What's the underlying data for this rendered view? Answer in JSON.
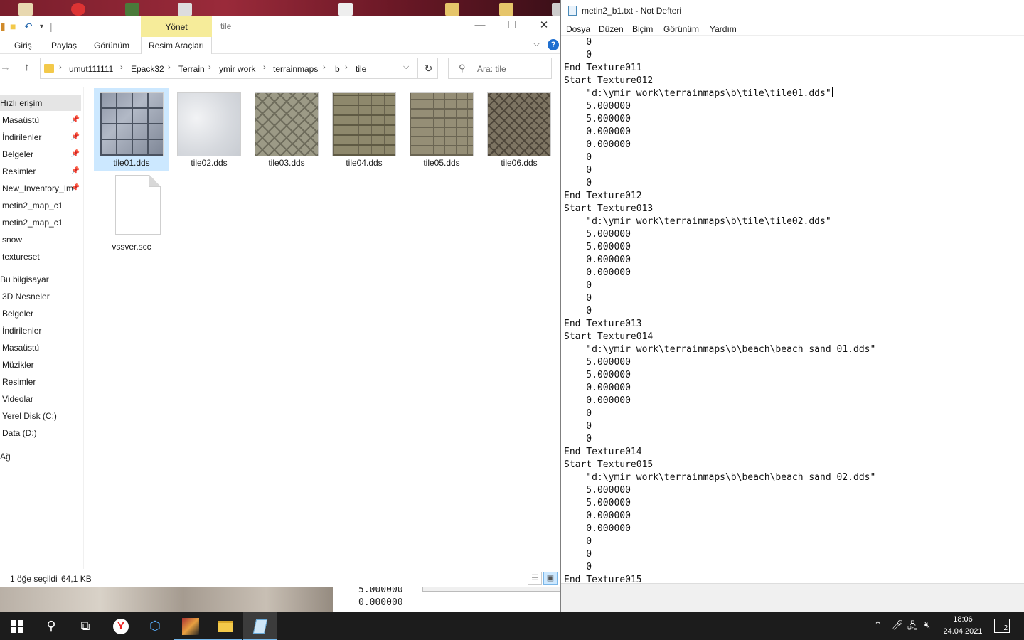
{
  "explorer": {
    "title": "tile",
    "manage_tab": "Yönet",
    "ribbon_tabs": [
      "Giriş",
      "Paylaş",
      "Görünüm",
      "Resim Araçları"
    ],
    "breadcrumb": [
      "umut111111",
      "Epack32",
      "Terrain",
      "ymir work",
      "terrainmaps",
      "b",
      "tile"
    ],
    "search_placeholder": "Ara: tile",
    "sidebar": [
      "Hızlı erişim",
      "Masaüstü",
      "İndirilenler",
      "Belgeler",
      "Resimler",
      "New_Inventory_Im",
      "metin2_map_c1",
      "metin2_map_c1",
      "snow",
      "textureset",
      "Bu bilgisayar",
      "3D Nesneler",
      "Belgeler",
      "İndirilenler",
      "Masaüstü",
      "Müzikler",
      "Resimler",
      "Videolar",
      "Yerel Disk (C:)",
      "Data (D:)",
      "Ağ"
    ],
    "files": [
      "tile01.dds",
      "tile02.dds",
      "tile03.dds",
      "tile04.dds",
      "tile05.dds",
      "tile06.dds",
      "vssver.scc"
    ],
    "status_selected": "1 öğe seçildi",
    "status_size": "64,1 KB"
  },
  "notepad": {
    "title": "metin2_b1.txt - Not Defteri",
    "menu": [
      "Dosya",
      "Düzen",
      "Biçim",
      "Görünüm",
      "Yardım"
    ],
    "lines": [
      "    0",
      "    0",
      "End Texture011",
      "Start Texture012",
      "    \"d:\\ymir work\\terrainmaps\\b\\tile\\tile01.dds\"",
      "    5.000000",
      "    5.000000",
      "    0.000000",
      "    0.000000",
      "    0",
      "    0",
      "    0",
      "End Texture012",
      "Start Texture013",
      "    \"d:\\ymir work\\terrainmaps\\b\\tile\\tile02.dds\"",
      "    5.000000",
      "    5.000000",
      "    0.000000",
      "    0.000000",
      "    0",
      "    0",
      "    0",
      "End Texture013",
      "Start Texture014",
      "    \"d:\\ymir work\\terrainmaps\\b\\beach\\beach sand 01.dds\"",
      "    5.000000",
      "    5.000000",
      "    0.000000",
      "    0.000000",
      "    0",
      "    0",
      "    0",
      "End Texture014",
      "Start Texture015",
      "    \"d:\\ymir work\\terrainmaps\\b\\beach\\beach sand 02.dds\"",
      "    5.000000",
      "    5.000000",
      "    0.000000",
      "    0.000000",
      "    0",
      "    0",
      "    0",
      "End Texture015"
    ]
  },
  "background_text": [
    "5.000000",
    "0.000000"
  ],
  "taskbar": {
    "time": "18:06",
    "date": "24.04.2021",
    "notifications": "2"
  },
  "colors": {
    "selection": "#cce8ff",
    "manage_tab": "#f6ec9a",
    "taskbar": "#1c1c1c"
  }
}
